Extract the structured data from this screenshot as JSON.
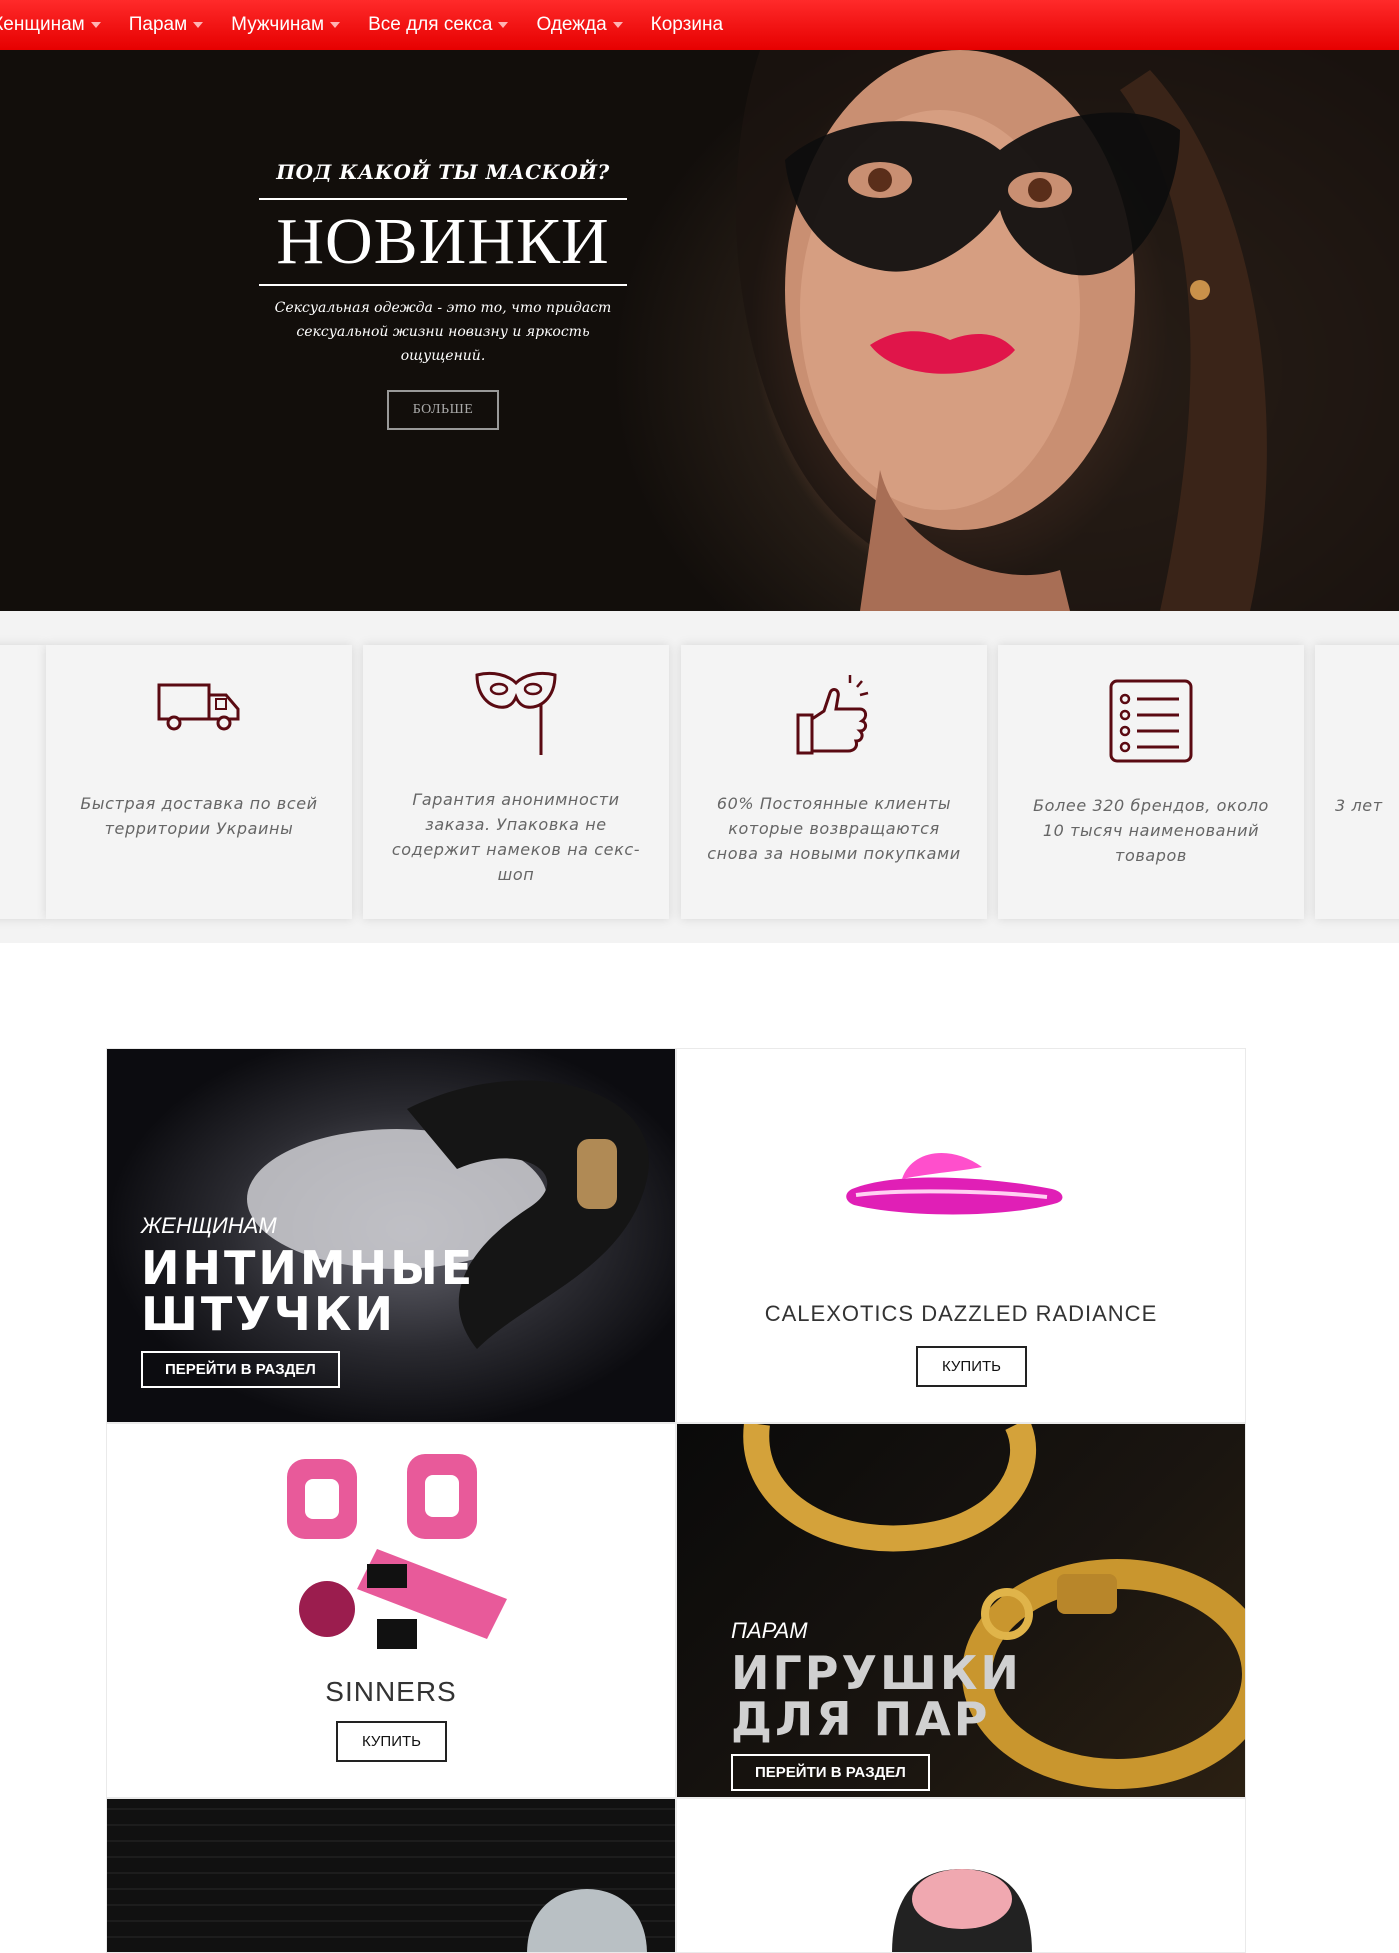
{
  "nav": {
    "items": [
      {
        "label": "Женщинам",
        "dropdown": true
      },
      {
        "label": "Парам",
        "dropdown": true
      },
      {
        "label": "Мужчинам",
        "dropdown": true
      },
      {
        "label": "Все для секса",
        "dropdown": true
      },
      {
        "label": "Одежда",
        "dropdown": true
      },
      {
        "label": "Корзина",
        "dropdown": false
      }
    ]
  },
  "hero": {
    "subtitle": "ПОД КАКОЙ ТЫ МАСКОЙ?",
    "title": "НОВИНКИ",
    "description_line1": "Сексуальная одежда - это то, что придаст",
    "description_line2": "сексуальной жизни новизну и яркость ощущений.",
    "button": "БОЛЬШЕ"
  },
  "features": [
    {
      "icon": "truck-icon",
      "text": "Быстрая доставка по всей территории Украины"
    },
    {
      "icon": "mask-icon",
      "text": "Гарантия анонимности заказа. Упаковка не содержит намеков на секс-шоп"
    },
    {
      "icon": "thumbs-up-icon",
      "text": "60% Постоянные клиенты которые возвращаются снова за новыми покупками"
    },
    {
      "icon": "list-icon",
      "text": "Более 320 брендов, около 10 тысяч наименований товаров"
    },
    {
      "icon": "",
      "text": "3 лет"
    }
  ],
  "tiles": {
    "women": {
      "category": "ЖЕНЩИНАМ",
      "title_line1": "ИНТИМНЫЕ",
      "title_line2": "ШТУЧКИ",
      "button": "ПЕРЕЙТИ В РАЗДЕЛ"
    },
    "product1": {
      "name": "CALEXOTICS DAZZLED RADIANCE",
      "button": "КУПИТЬ"
    },
    "product2": {
      "name": "SINNERS",
      "button": "КУПИТЬ"
    },
    "couples": {
      "category": "ПАРАМ",
      "title_line1": "ИГРУШКИ",
      "title_line2": "ДЛЯ ПАР",
      "button": "ПЕРЕЙТИ В РАЗДЕЛ"
    }
  },
  "colors": {
    "accent": "#ff1a1a",
    "icon": "#5a0a12"
  }
}
